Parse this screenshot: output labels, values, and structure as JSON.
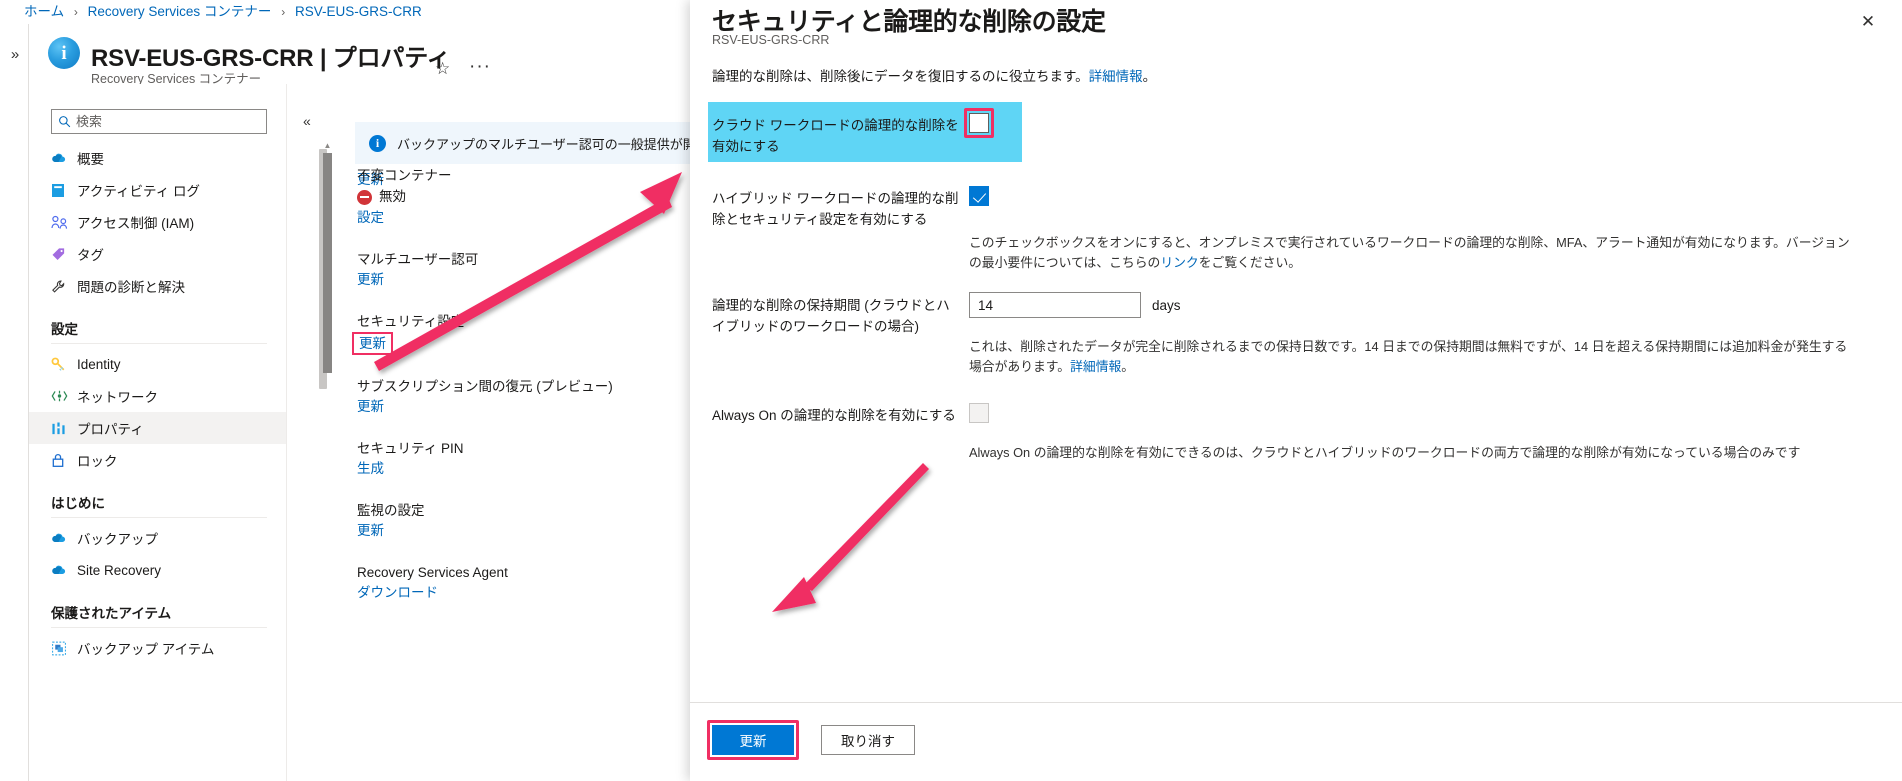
{
  "breadcrumb": {
    "items": [
      "ホーム",
      "Recovery Services コンテナー",
      "RSV-EUS-GRS-CRR"
    ],
    "separator": "›"
  },
  "blade": {
    "title": "RSV-EUS-GRS-CRR | プロパティ",
    "subtitle": "Recovery Services コンテナー",
    "vault_icon_glyph": "i",
    "favorite_icon": "☆",
    "more_icon": "···",
    "collapse_icon": "«",
    "rail_expand_icon": "»"
  },
  "sidebar": {
    "search": {
      "placeholder": "検索",
      "value": "",
      "icon": "search-icon"
    },
    "items": [
      {
        "type": "item",
        "label": "概要",
        "icon": "cloud-icon",
        "selected": false
      },
      {
        "type": "item",
        "label": "アクティビティ ログ",
        "icon": "log-book-icon",
        "selected": false
      },
      {
        "type": "item",
        "label": "アクセス制御 (IAM)",
        "icon": "people-icon",
        "selected": false
      },
      {
        "type": "item",
        "label": "タグ",
        "icon": "tag-icon",
        "selected": false
      },
      {
        "type": "item",
        "label": "問題の診断と解決",
        "icon": "wrench-icon",
        "selected": false
      },
      {
        "type": "group",
        "label": "設定"
      },
      {
        "type": "item",
        "label": "Identity",
        "icon": "key-icon",
        "selected": false
      },
      {
        "type": "item",
        "label": "ネットワーク",
        "icon": "network-icon",
        "selected": false
      },
      {
        "type": "item",
        "label": "プロパティ",
        "icon": "properties-icon",
        "selected": true
      },
      {
        "type": "item",
        "label": "ロック",
        "icon": "lock-icon",
        "selected": false
      },
      {
        "type": "group",
        "label": "はじめに"
      },
      {
        "type": "item",
        "label": "バックアップ",
        "icon": "cloud-icon",
        "selected": false
      },
      {
        "type": "item",
        "label": "Site Recovery",
        "icon": "cloud-icon",
        "selected": false
      },
      {
        "type": "group",
        "label": "保護されたアイテム"
      },
      {
        "type": "item",
        "label": "バックアップ アイテム",
        "icon": "backup-item-icon",
        "selected": false
      }
    ]
  },
  "content": {
    "banner": {
      "icon": "info-icon",
      "text": "バックアップのマルチユーザー認可の一般提供が開始されました。構成"
    },
    "first_link": "更新",
    "properties": [
      {
        "name": "不変コンテナー",
        "status": "無効",
        "status_icon": "deny-icon",
        "link": "設定",
        "highlighted": false
      },
      {
        "name": "マルチユーザー認可",
        "status": "",
        "link": "更新",
        "highlighted": false
      },
      {
        "name": "セキュリティ設定",
        "status": "",
        "link": "更新",
        "highlighted": true
      },
      {
        "name": "サブスクリプション間の復元 (プレビュー)",
        "status": "",
        "link": "更新",
        "highlighted": false
      },
      {
        "name": "セキュリティ PIN",
        "status": "",
        "link": "生成",
        "highlighted": false
      },
      {
        "name": "監視の設定",
        "status": "",
        "link": "更新",
        "highlighted": false
      },
      {
        "name": "Recovery Services Agent",
        "status": "",
        "link": "ダウンロード",
        "highlighted": false
      }
    ]
  },
  "flyout": {
    "title": "セキュリティと論理的な削除の設定",
    "subtitle": "RSV-EUS-GRS-CRR",
    "close_icon": "✕",
    "description_text": "論理的な削除は、削除後にデータを復旧するのに役立ちます。",
    "description_link": "詳細情報",
    "description_tail": "。",
    "rows": [
      {
        "id": "cloud-soft-delete",
        "label": "クラウド ワークロードの論理的な削除を有効にする",
        "control": "checkbox",
        "checked": false,
        "disabled": false,
        "highlighted": true,
        "annotated": true,
        "help": ""
      },
      {
        "id": "hybrid-soft-delete",
        "label": "ハイブリッド ワークロードの論理的な削除とセキュリティ設定を有効にする",
        "control": "checkbox",
        "checked": true,
        "disabled": false,
        "highlighted": false,
        "annotated": false,
        "help_prefix": "このチェックボックスをオンにすると、オンプレミスで実行されているワークロードの論理的な削除、MFA、アラート通知が有効になります。バージョンの最小要件については、こちらの",
        "help_link": "リンク",
        "help_suffix": "をご覧ください。"
      },
      {
        "id": "retention-period",
        "label": "論理的な削除の保持期間 (クラウドとハイブリッドのワークロードの場合)",
        "control": "textbox",
        "value": "14",
        "unit": "days",
        "help_prefix": "これは、削除されたデータが完全に削除されるまでの保持日数です。14 日までの保持期間は無料ですが、14 日を超える保持期間には追加料金が発生する場合があります。",
        "help_link": "詳細情報",
        "help_suffix": "。"
      },
      {
        "id": "always-on-soft-delete",
        "label": "Always On の論理的な削除を有効にする",
        "control": "checkbox",
        "checked": false,
        "disabled": true,
        "highlighted": false,
        "annotated": false,
        "help_prefix": "Always On の論理的な削除を有効にできるのは、クラウドとハイブリッドのワークロードの両方で論理的な削除が有効になっている場合のみです",
        "help_link": "",
        "help_suffix": ""
      }
    ],
    "footer": {
      "update_label": "更新",
      "cancel_label": "取り消す"
    }
  },
  "annotations": {
    "arrow_color": "#f02f63",
    "highlight_color": "#5fd5f5",
    "accent_color": "#0078d4",
    "link_color": "#0067b8"
  }
}
